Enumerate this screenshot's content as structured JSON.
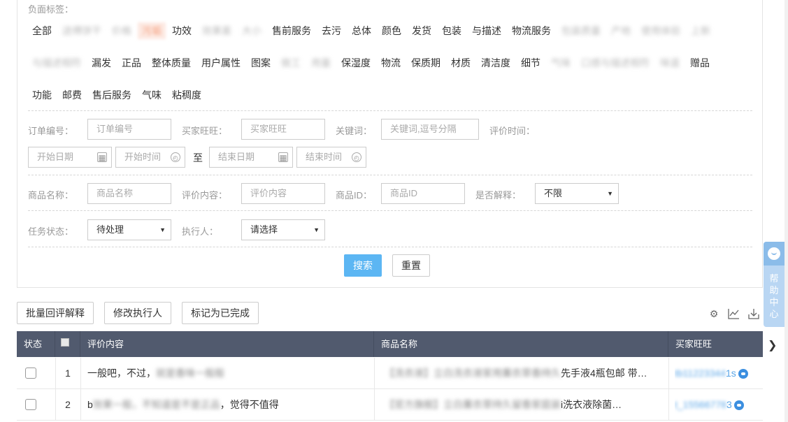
{
  "filters": {
    "negative_tags_label": "负面标签：",
    "tags_row1": [
      {
        "label": "全部",
        "style": "normal"
      },
      {
        "label": "送傅饼干",
        "style": "blur"
      },
      {
        "label": "价格",
        "style": "blur"
      },
      {
        "label": "污垢",
        "style": "highlight"
      },
      {
        "label": "功效",
        "style": "normal"
      },
      {
        "label": "效果差",
        "style": "blur"
      },
      {
        "label": "大小",
        "style": "blur"
      },
      {
        "label": "售前服务",
        "style": "normal"
      },
      {
        "label": "去污",
        "style": "normal"
      },
      {
        "label": "总体",
        "style": "normal"
      },
      {
        "label": "颜色",
        "style": "normal"
      },
      {
        "label": "发货",
        "style": "normal"
      },
      {
        "label": "包装",
        "style": "normal"
      },
      {
        "label": "与描述",
        "style": "normal"
      },
      {
        "label": "物流服务",
        "style": "normal"
      },
      {
        "label": "包装质量",
        "style": "blur"
      },
      {
        "label": "产地",
        "style": "blur"
      },
      {
        "label": "使用体验",
        "style": "blur"
      },
      {
        "label": "上新",
        "style": "blur"
      }
    ],
    "tags_row2": [
      {
        "label": "与描述相符",
        "style": "blur"
      },
      {
        "label": "漏发",
        "style": "normal"
      },
      {
        "label": "正品",
        "style": "normal"
      },
      {
        "label": "整体质量",
        "style": "normal"
      },
      {
        "label": "用户属性",
        "style": "normal"
      },
      {
        "label": "图案",
        "style": "normal"
      },
      {
        "label": "做工",
        "style": "blur"
      },
      {
        "label": "用量",
        "style": "blur"
      },
      {
        "label": "保湿度",
        "style": "normal"
      },
      {
        "label": "物流",
        "style": "normal"
      },
      {
        "label": "保质期",
        "style": "normal"
      },
      {
        "label": "材质",
        "style": "normal"
      },
      {
        "label": "清洁度",
        "style": "normal"
      },
      {
        "label": "细节",
        "style": "normal"
      },
      {
        "label": "气味",
        "style": "blur"
      },
      {
        "label": "口感与描述相符",
        "style": "blur"
      },
      {
        "label": "味道",
        "style": "blur"
      },
      {
        "label": "赠品",
        "style": "normal"
      }
    ],
    "tags_row3": [
      {
        "label": "功能",
        "style": "normal"
      },
      {
        "label": "邮费",
        "style": "normal"
      },
      {
        "label": "售后服务",
        "style": "normal"
      },
      {
        "label": "气味",
        "style": "normal"
      },
      {
        "label": "粘稠度",
        "style": "normal"
      }
    ],
    "order_no_label": "订单编号：",
    "order_no_placeholder": "订单编号",
    "buyer_label": "买家旺旺：",
    "buyer_placeholder": "买家旺旺",
    "keyword_label": "关键词：",
    "keyword_placeholder": "关键词,逗号分隔",
    "review_time_label": "评价时间：",
    "start_date_placeholder": "开始日期",
    "start_time_placeholder": "开始时间",
    "to_label": "至",
    "end_date_placeholder": "结束日期",
    "end_time_placeholder": "结束时间",
    "product_name_label": "商品名称：",
    "product_name_placeholder": "商品名称",
    "review_content_label": "评价内容：",
    "review_content_placeholder": "评价内容",
    "product_id_label": "商品ID：",
    "product_id_placeholder": "商品ID",
    "explained_label": "是否解释：",
    "explained_value": "不限",
    "task_status_label": "任务状态：",
    "task_status_value": "待处理",
    "executor_label": "执行人：",
    "executor_value": "请选择",
    "search_button": "搜索",
    "reset_button": "重置"
  },
  "toolbar": {
    "batch_reply": "批量回评解释",
    "modify_executor": "修改执行人",
    "mark_done": "标记为已完成",
    "icons": [
      "gear-icon",
      "line-chart-icon",
      "download-icon"
    ]
  },
  "table": {
    "headers": [
      "状态",
      "评价内容",
      "商品名称",
      "买家旺旺"
    ],
    "rows": [
      {
        "index": "1",
        "review_prefix": "一般吧，不过，",
        "review_blur": "就是香味一般般",
        "review_suffix": "",
        "product_blur": "【洗衣液】立白洗衣液家用薰衣草香持久",
        "product_suffix": "先手液4瓶包邮 带…",
        "buyer_blur": "tb11223344",
        "buyer_suffix": "1s"
      },
      {
        "index": "2",
        "review_prefix": "b",
        "review_blur": "效果一般，不知道是不是正品",
        "review_suffix": "，觉得不值得",
        "product_blur": "【官方旗舰】立白薰衣草持久留香家庭装",
        "product_suffix": "i洗衣液除菌…",
        "buyer_blur": "t_15566778",
        "buyer_suffix": "3"
      }
    ]
  },
  "help": {
    "text": "帮助中心"
  }
}
